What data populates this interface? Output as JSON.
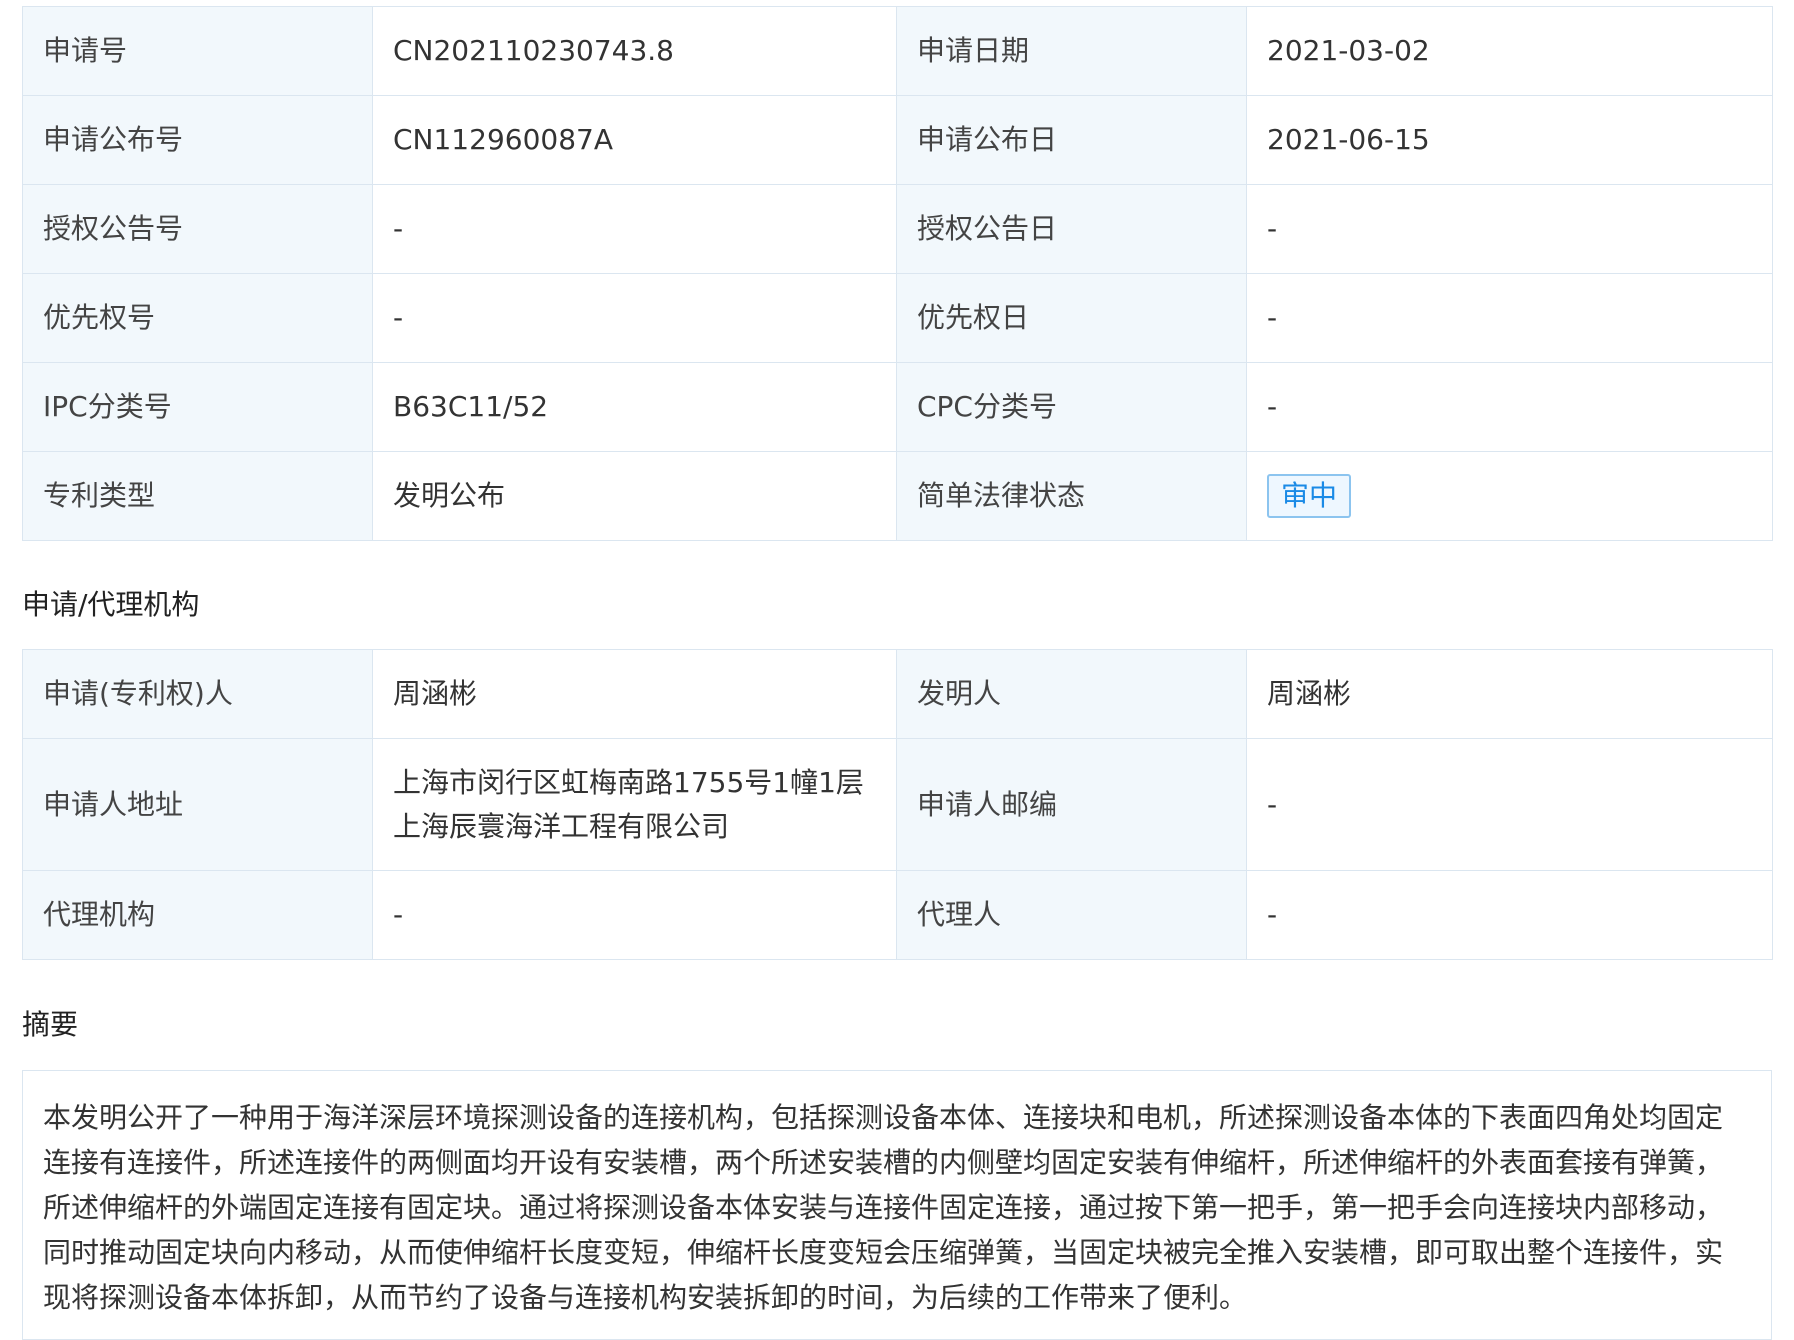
{
  "basic_info": {
    "rows": [
      {
        "label1": "申请号",
        "value1": "CN202110230743.8",
        "label2": "申请日期",
        "value2": "2021-03-02"
      },
      {
        "label1": "申请公布号",
        "value1": "CN112960087A",
        "label2": "申请公布日",
        "value2": "2021-06-15"
      },
      {
        "label1": "授权公告号",
        "value1": "-",
        "label2": "授权公告日",
        "value2": "-"
      },
      {
        "label1": "优先权号",
        "value1": "-",
        "label2": "优先权日",
        "value2": "-"
      },
      {
        "label1": "IPC分类号",
        "value1": "B63C11/52",
        "label2": "CPC分类号",
        "value2": "-"
      },
      {
        "label1": "专利类型",
        "value1": "发明公布",
        "label2": "简单法律状态",
        "value2": "审中"
      }
    ],
    "status_color": "#1a8ae6"
  },
  "agency": {
    "heading": "申请/代理机构",
    "rows": [
      {
        "label1": "申请(专利权)人",
        "value1": "周涵彬",
        "label2": "发明人",
        "value2": "周涵彬"
      },
      {
        "label1": "申请人地址",
        "value1_line1": "上海市闵行区虹梅南路1755号1幢1层",
        "value1_line2": "上海辰寰海洋工程有限公司",
        "label2": "申请人邮编",
        "value2": "-"
      },
      {
        "label1": "代理机构",
        "value1": "-",
        "label2": "代理人",
        "value2": "-"
      }
    ]
  },
  "abstract": {
    "heading": "摘要",
    "lines": [
      "本发明公开了一种用于海洋深层环境探测设备的连接机构，包括探测设备本体、连接块和电机，所述探测设备本体的下表面四角处均固定",
      "连接有连接件，所述连接件的两侧面均开设有安装槽，两个所述安装槽的内侧壁均固定安装有伸缩杆，所述伸缩杆的外表面套接有弹簧，",
      "所述伸缩杆的外端固定连接有固定块。通过将探测设备本体安装与连接件固定连接，通过按下第一把手，第一把手会向连接块内部移动，",
      "同时推动固定块向内移动，从而使伸缩杆长度变短，伸缩杆长度变短会压缩弹簧，当固定块被完全推入安装槽，即可取出整个连接件，实",
      "现将探测设备本体拆卸，从而节约了设备与连接机构安装拆卸的时间，为后续的工作带来了便利。"
    ]
  }
}
